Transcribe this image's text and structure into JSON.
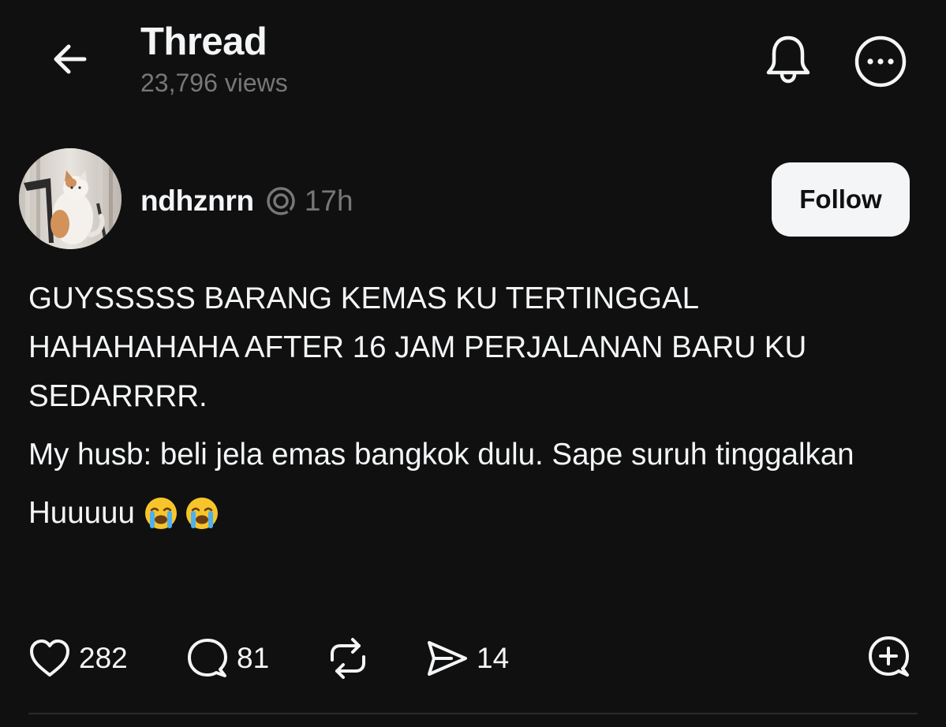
{
  "header": {
    "title": "Thread",
    "views": "23,796 views",
    "back_icon": "arrow-left-icon",
    "bell_icon": "bell-icon",
    "more_icon": "more-horizontal-circle-icon"
  },
  "post": {
    "author": {
      "username": "ndhznrn",
      "verified_icon": "threads-badge-icon",
      "time": "17h",
      "avatar": "cat-photo-avatar"
    },
    "follow_label": "Follow",
    "paragraphs": [
      "GUYSSSSS BARANG KEMAS KU TERTINGGAL HAHAHAHAHA AFTER 16 JAM PERJALANAN BARU KU SEDARRRR.",
      "My husb: beli jela emas bangkok dulu. Sape suruh tinggalkan",
      "Huuuuu"
    ],
    "emojis": [
      "loudly-crying-face",
      "loudly-crying-face"
    ],
    "actions": {
      "likes": "282",
      "replies": "81",
      "shares": "14"
    }
  },
  "colors": {
    "background": "#101010",
    "text_primary": "#f3f5f7",
    "text_secondary": "#777777",
    "button_bg": "#f3f5f7"
  }
}
